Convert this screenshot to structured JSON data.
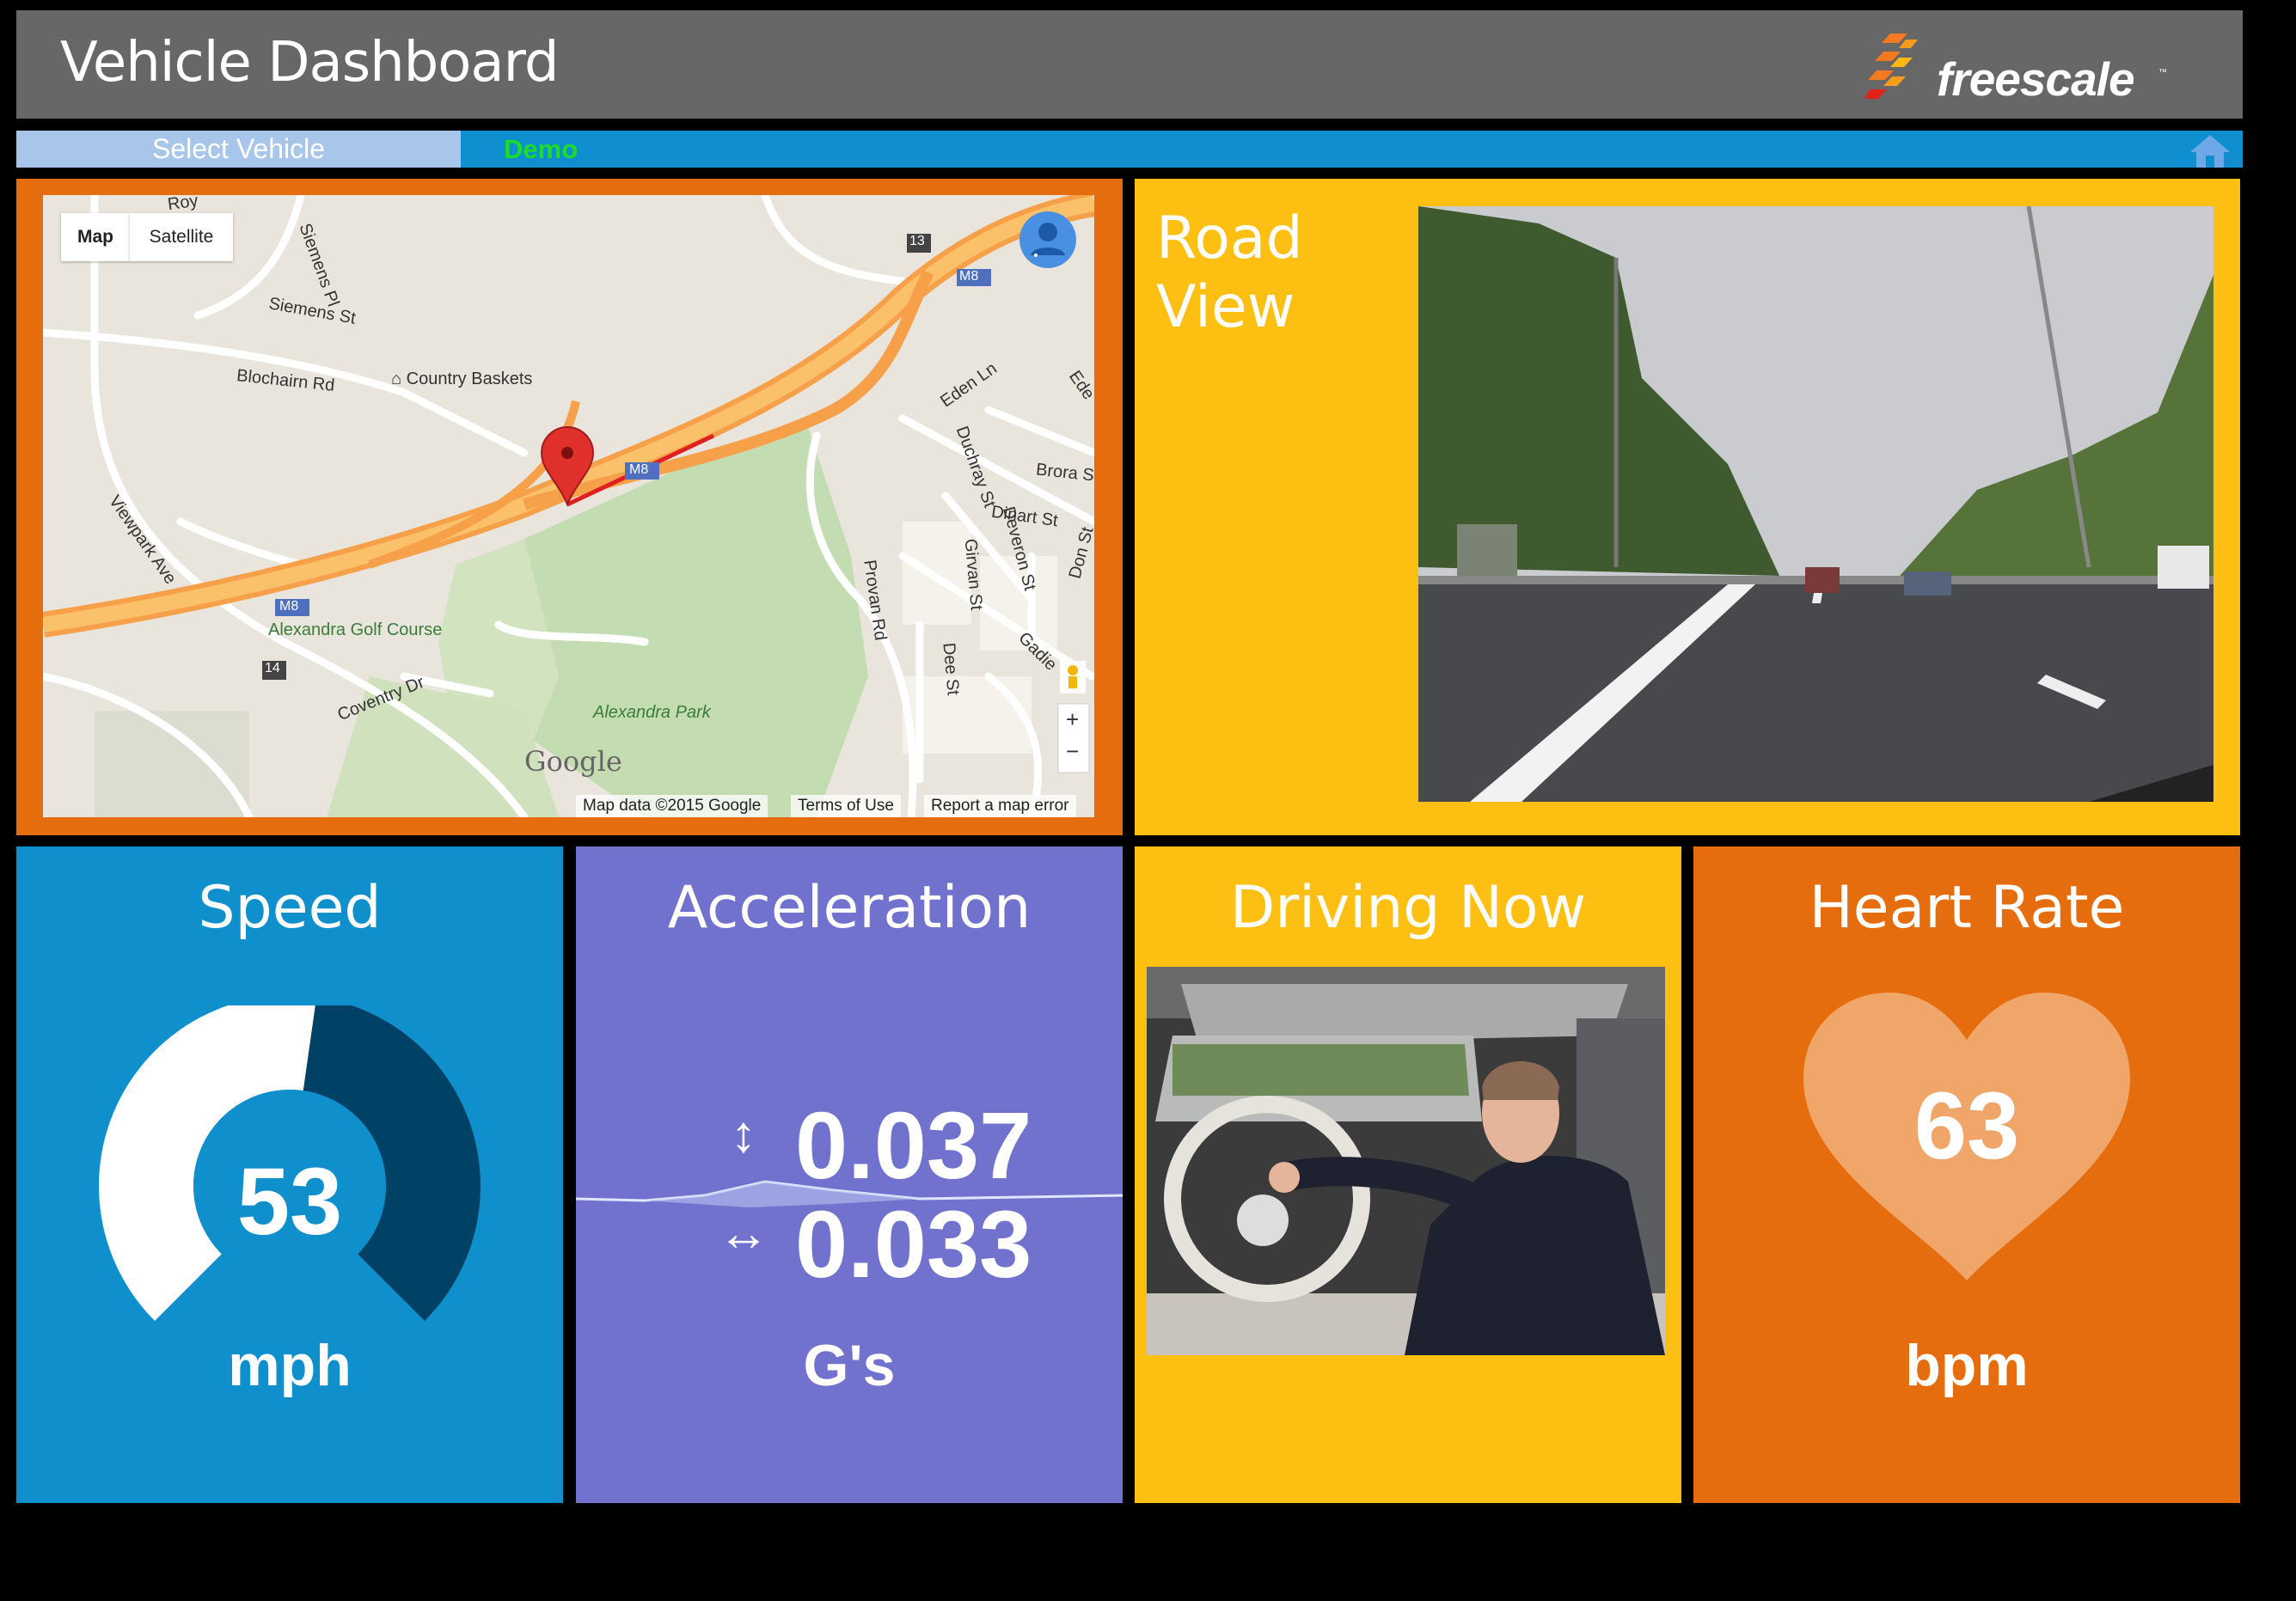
{
  "header": {
    "title": "Vehicle Dashboard",
    "brand": "freescale",
    "brand_tm": "™"
  },
  "nav": {
    "select_vehicle": "Select Vehicle",
    "demo": "Demo"
  },
  "map": {
    "type_map": "Map",
    "type_satellite": "Satellite",
    "labels": {
      "royston": "Roy",
      "siemens_pl": "Siemens Pl",
      "siemens_st": "Siemens St",
      "blochairn": "Blochairn Rd",
      "country_baskets": "Country Baskets",
      "m8": "M8",
      "j13": "13",
      "j14": "14",
      "eden": "Eden Ln",
      "edenb": "Ede",
      "brora": "Brora S",
      "duchray": "Duchray St",
      "dinart": "Dinart St",
      "don": "Don St",
      "deveron": "Deveron St",
      "girvan": "Girvan St",
      "provan": "Provan Rd",
      "dee": "Dee St",
      "gadie": "Gadie",
      "viewpark": "Viewpark Ave",
      "golf": "Alexandra Golf Course",
      "coventry": "Coventry Dr",
      "park": "Alexandra Park",
      "google": "Google"
    },
    "footer": {
      "data": "Map data ©2015 Google",
      "terms": "Terms of Use",
      "report": "Report a map error"
    },
    "zoom_in": "+",
    "zoom_out": "−"
  },
  "road": {
    "title_line1": "Road",
    "title_line2": "View"
  },
  "speed": {
    "title": "Speed",
    "value": "53",
    "unit": "mph",
    "gauge_fraction": 0.53
  },
  "accel": {
    "title": "Acceleration",
    "vertical": "0.037",
    "horizontal": "0.033",
    "unit": "G's",
    "v_icon": "↕",
    "h_icon": "↔"
  },
  "driver": {
    "title": "Driving Now"
  },
  "heart": {
    "title": "Heart Rate",
    "value": "63",
    "unit": "bpm"
  },
  "colors": {
    "header": "#676767",
    "nav": "#0f8fd0",
    "select": "#a8c6ea",
    "demo": "#1cdc27",
    "orange": "#e66d0e",
    "yellow": "#fdbf11",
    "blue": "#0f8fcb",
    "purple": "#7172cd"
  }
}
